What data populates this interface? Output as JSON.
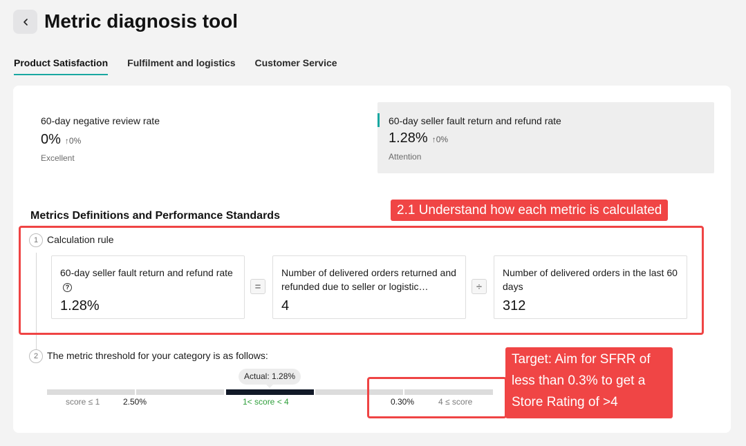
{
  "header": {
    "back_icon": "chevron-left-icon",
    "title": "Metric diagnosis tool"
  },
  "tabs": [
    {
      "label": "Product Satisfaction",
      "active": true
    },
    {
      "label": "Fulfilment and logistics",
      "active": false
    },
    {
      "label": "Customer Service",
      "active": false
    }
  ],
  "metrics": [
    {
      "title": "60-day negative review rate",
      "value": "0%",
      "change": "↑0%",
      "status": "Excellent"
    },
    {
      "title": "60-day seller fault return and refund rate",
      "value": "1.28%",
      "change": "↑0%",
      "status": "Attention"
    }
  ],
  "definitions": {
    "heading": "Metrics Definitions and Performance Standards",
    "step1": {
      "number": "1",
      "title": "Calculation rule",
      "boxes": [
        {
          "label": "60-day seller fault return and refund rate",
          "value": "1.28%"
        },
        {
          "label": "Number of delivered orders returned and refunded due to seller or logistic…",
          "value": "4"
        },
        {
          "label": "Number of delivered orders in the last 60 days",
          "value": "312"
        }
      ],
      "operators": [
        "=",
        "÷"
      ]
    },
    "step2": {
      "number": "2",
      "title": "The metric threshold for your category is as follows:",
      "actual_label": "Actual: 1.28%",
      "labels": {
        "score_low": "score ≤ 1",
        "threshold_high": "2.50%",
        "score_mid": "1< score < 4",
        "threshold_low": "0.30%",
        "score_high": "4 ≤ score"
      },
      "mid_label_color": "#2e9e3a"
    }
  },
  "annotations": {
    "callout1": "2.1 Understand how each metric is calculated",
    "callout2_lines": [
      "Target: Aim for SFRR of",
      "less than 0.3% to get a",
      "Store Rating of >4"
    ],
    "color": "#f04545"
  },
  "colors": {
    "accent": "#18a7a1",
    "active_bar": "#121a28"
  }
}
